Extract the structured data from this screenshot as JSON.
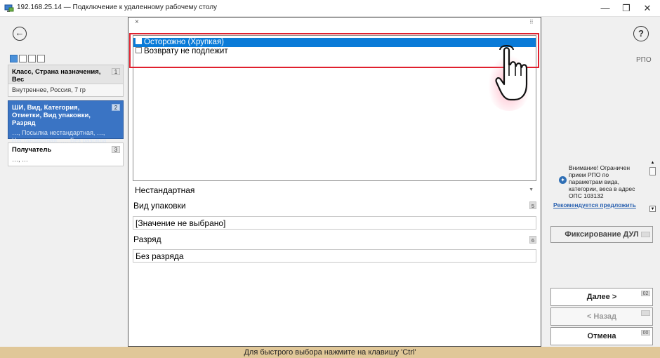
{
  "window": {
    "title": "192.168.25.14 — Подключение к удаленному рабочему столу",
    "minimize": "—",
    "maximize": "❐",
    "close": "✕"
  },
  "header": {
    "back_icon": "←",
    "help_icon": "?"
  },
  "steps": [
    {
      "title": "Класс, Страна назначения, Вес",
      "summary": "Внутреннее, Россия, 7 гр",
      "number": "1"
    },
    {
      "title": "ШИ, Вид, Категория, Отметки, Вид упаковки, Разряд",
      "summary": "…, Посылка нестандартная, …, Нестандартная, …, Без разряда",
      "number": "2"
    },
    {
      "title": "Получатель",
      "summary": "…, …",
      "number": "3"
    }
  ],
  "dialog": {
    "close_icon": "×",
    "grip": "⠿",
    "options": [
      {
        "label": "Осторожно (Хрупкая)",
        "selected": true
      },
      {
        "label": "Возврату не подлежит",
        "selected": false
      }
    ],
    "nonstandard_value": "Нестандартная",
    "dropdown_arrow": "▼",
    "packaging": {
      "label": "Вид упаковки",
      "num": "5",
      "value": "[Значение не выбрано]"
    },
    "category": {
      "label": "Разряд",
      "num": "6",
      "value": "Без разряда"
    }
  },
  "right_panel": {
    "rpo_label": "РПО",
    "notice_text": "Внимание! Ограничен прием РПО по параметрам вида, категории, веса в адрес ОПС 103132",
    "notice_link": "Рекомендуется предложить",
    "star_icon": "✦",
    "scroll_up_icon": "▲",
    "scroll_down_icon": "▼",
    "fix_button": {
      "label": "Фиксирование ДУЛ",
      "badge": ""
    },
    "next_button": {
      "label": "Далее >",
      "badge": "02"
    },
    "prev_button": {
      "label": "< Назад",
      "badge": ""
    },
    "cancel_button": {
      "label": "Отмена",
      "badge": "00"
    }
  },
  "footer": {
    "hint": "Для быстрого выбора нажмите на клавишу 'Ctrl'"
  },
  "colors": {
    "selection": "#0a7bd8",
    "active_step": "#3a74c4",
    "footer_bg": "#e0c798",
    "highlight_border": "#e0202e"
  }
}
